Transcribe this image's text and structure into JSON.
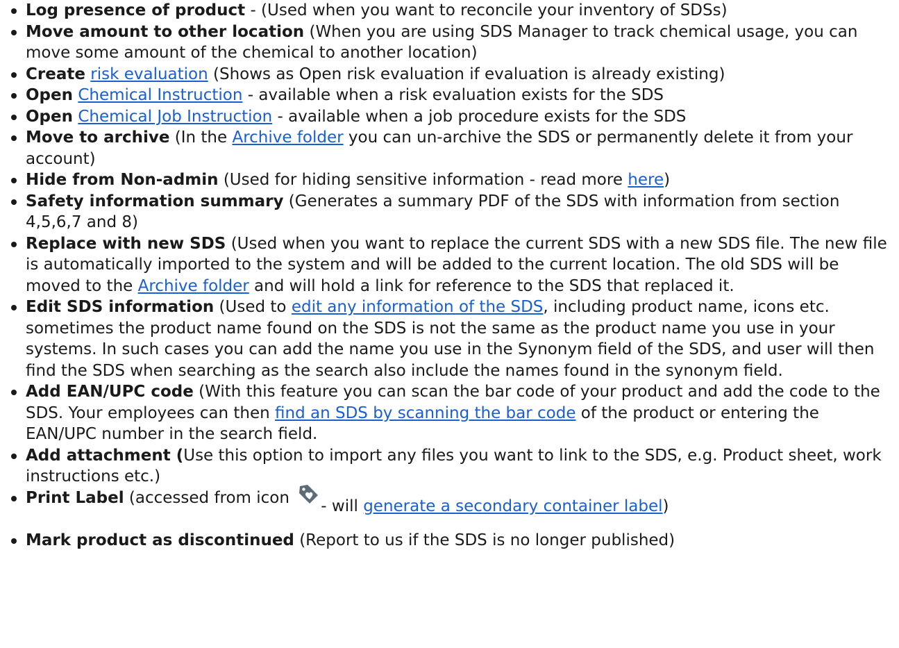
{
  "items": [
    {
      "title": "Log presence of product",
      "text": " - (Used when you want to reconcile your inventory of SDSs)"
    },
    {
      "title": "Move amount to other location",
      "text": " (When you are using SDS Manager to track chemical usage, you can move some amount of the chemical to another location)"
    },
    {
      "title": "Create",
      "link": "risk evaluation",
      "text": " (Shows as Open risk evaluation if evaluation is already existing)"
    },
    {
      "title": "Open",
      "link": "Chemical Instruction",
      "text": " - available when a risk evaluation exists for the SDS"
    },
    {
      "title": "Open",
      "link": "Chemical Job Instruction",
      "text": " - available when a job procedure exists for the SDS"
    },
    {
      "title": "Move to archive",
      "pre": " (In the ",
      "link": "Archive folder",
      "text": " you can un-archive the SDS or permanently delete it from your account)"
    },
    {
      "title": "Hide from Non-admin",
      "pre": " (Used for hiding sensitive information - read more ",
      "link": "here",
      "text": ")"
    },
    {
      "title": "Safety information summary",
      "text": " (Generates a summary PDF of the SDS with information from section 4,5,6,7 and 8)"
    },
    {
      "title": "Replace with new SDS",
      "pre": " (Used when you want to replace the current SDS with a new SDS file. The new file is automatically imported to the system and will be added to the current location.  The old SDS will be moved to the ",
      "link": "Archive folder",
      "text": " and will hold a link for reference to the SDS that replaced it."
    },
    {
      "title": "Edit SDS information",
      "pre": " (Used to ",
      "link": "edit any information of the SDS",
      "text": ", including product name, icons etc. sometimes the product name found on the SDS is not the same as the product name you use in your systems.  In such cases you can add the name you use in the Synonym field of the SDS, and user will then find the SDS when searching as the search also include the names found in the synonym field."
    },
    {
      "title": "Add EAN/UPC code",
      "pre": " (With this feature you can scan the bar code of your product and add the code to the SDS. Your employees can then ",
      "link": "find an SDS by scanning the bar code",
      "text": " of the product or entering the EAN/UPC number in the search field."
    },
    {
      "title": "Add attachment (",
      "text": "Use this option to import any files you want to link to the SDS, e.g. Product sheet, work instructions etc.)"
    },
    {
      "title": "Print Label",
      "pre": " (accessed from icon ",
      "icon": "tag-heart-icon",
      "mid": " - will ",
      "link": "generate a secondary container label",
      "text": ")"
    },
    {
      "title": "Mark product as discontinued",
      "text": " (Report to us if the SDS is no longer published)"
    }
  ],
  "colors": {
    "text": "#1a1a1a",
    "link": "#1a5fd0",
    "icon": "#5d6b78"
  }
}
